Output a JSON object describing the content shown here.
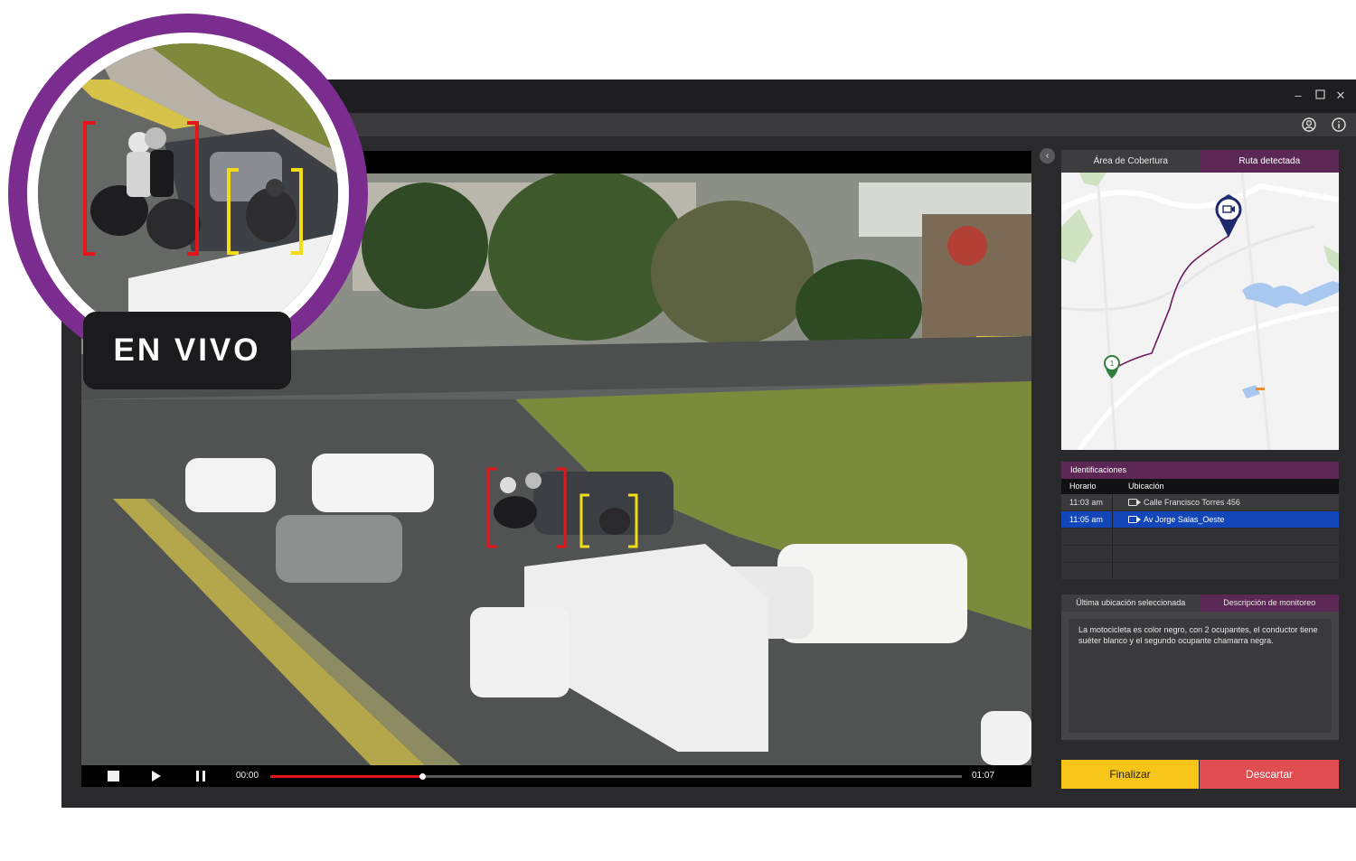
{
  "live_badge": {
    "label": "EN VIVO"
  },
  "video": {
    "time_current": "00:00",
    "time_total": "01:07",
    "progress": 0.22
  },
  "panel": {
    "tabs": [
      {
        "label": "Área de Cobertura",
        "active": false
      },
      {
        "label": "Ruta detectada",
        "active": true
      }
    ],
    "identificaciones": {
      "title": "Identificaciones",
      "columns": [
        "Horario",
        "Ubicación"
      ],
      "rows": [
        {
          "time": "11:03 am",
          "location": "Calle Francisco Torres 456",
          "selected": false
        },
        {
          "time": "11:05 am",
          "location": "Av Jorge Salas_Oeste",
          "selected": true
        }
      ]
    },
    "lower_tabs": [
      {
        "label": "Última ubicación seleccionada",
        "active": false
      },
      {
        "label": "Descripción de monitoreo",
        "active": true
      }
    ],
    "description": "La motocicleta es color negro, con 2 ocupantes, el conductor tiene suéter blanco y el segundo ocupante chamarra negra.",
    "buttons": {
      "finish": "Finalizar",
      "discard": "Descartar"
    },
    "map": {
      "start_marker_label": "1"
    }
  },
  "colors": {
    "accent_purple": "#5b2855",
    "ring_purple": "#7b2d8f",
    "selected_row": "#1346b8",
    "finish_yellow": "#f6c518",
    "discard_red": "#e04e52",
    "progress_red": "#e3151b"
  }
}
